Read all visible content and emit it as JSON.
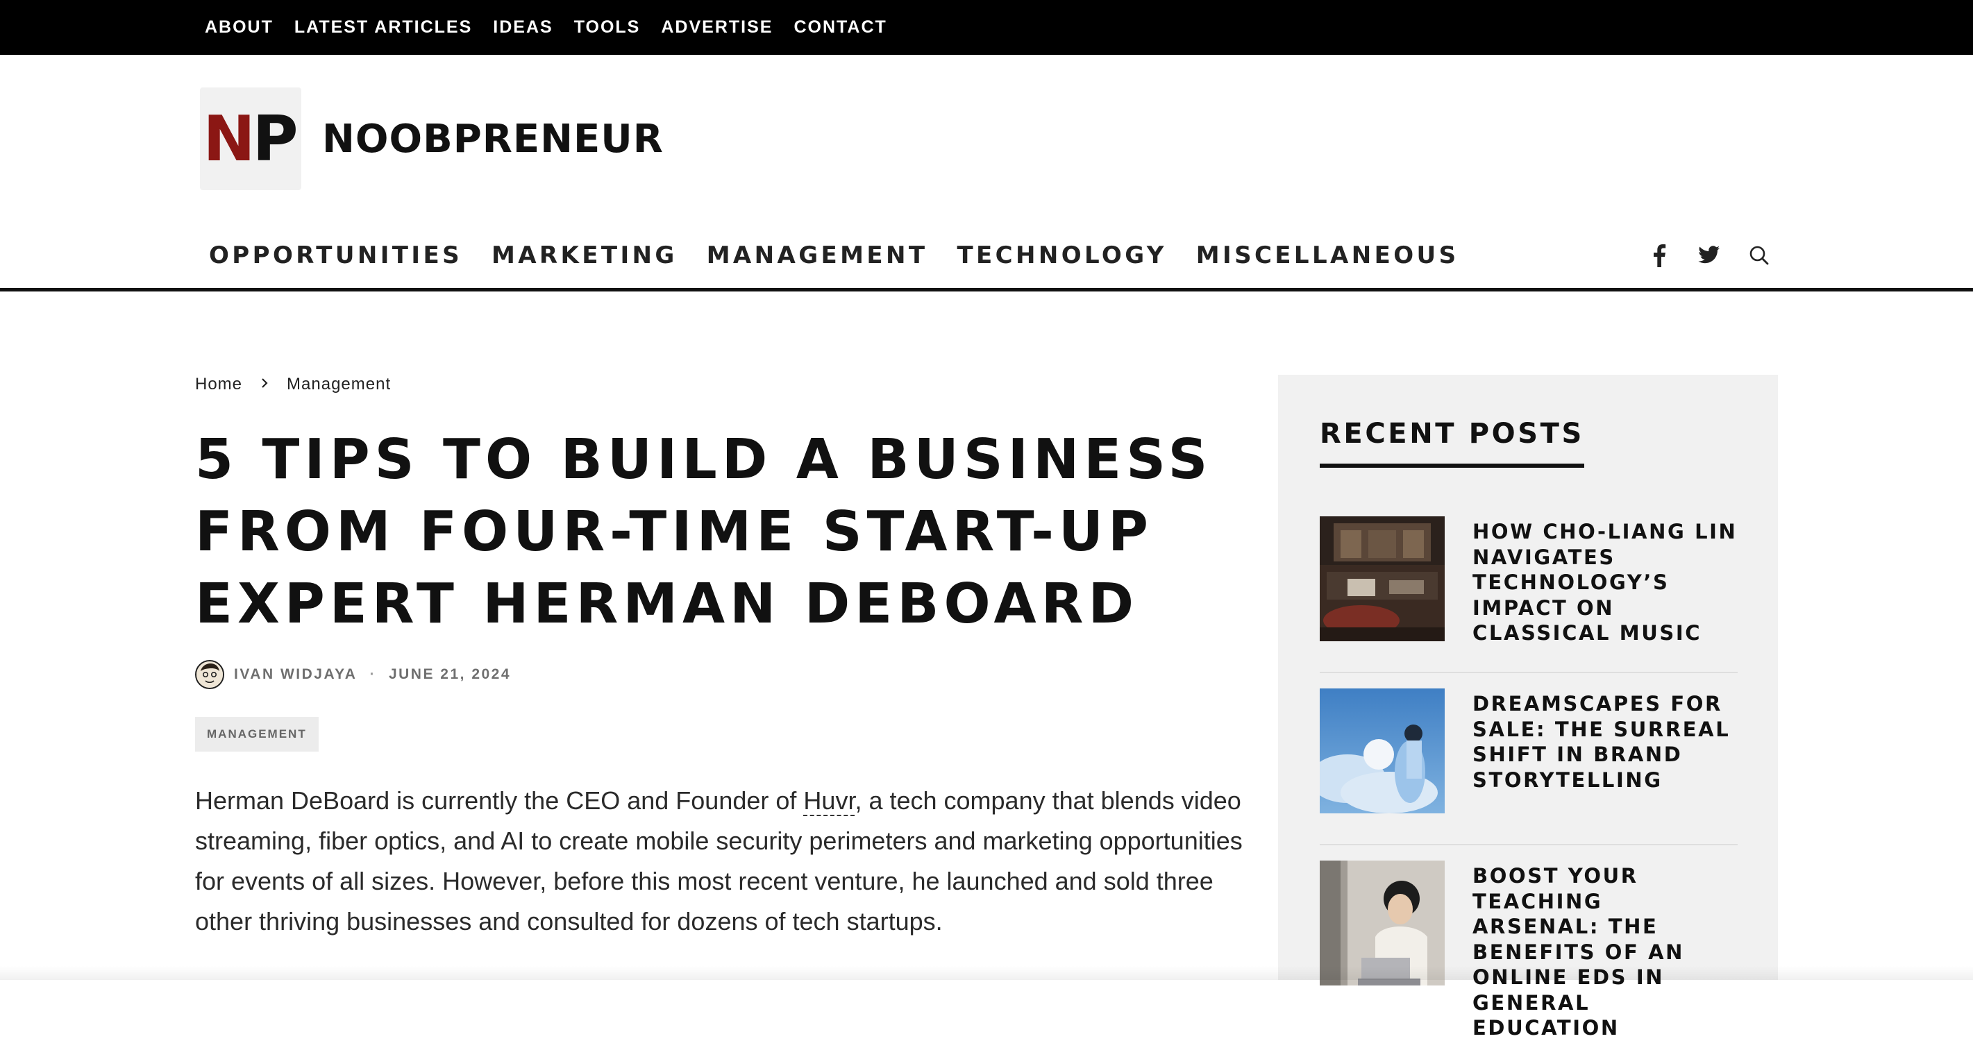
{
  "topbar": {
    "links": [
      "ABOUT",
      "LATEST ARTICLES",
      "IDEAS",
      "TOOLS",
      "ADVERTISE",
      "CONTACT"
    ]
  },
  "brand": {
    "logo_letter_1": "N",
    "logo_letter_2": "P",
    "name": "NOOBPRENEUR",
    "colors": {
      "logo_n": "#8b1714",
      "logo_p": "#111111"
    }
  },
  "mainnav": {
    "items": [
      "OPPORTUNITIES",
      "MARKETING",
      "MANAGEMENT",
      "TECHNOLOGY",
      "MISCELLANEOUS"
    ],
    "icons": [
      "facebook-icon",
      "twitter-icon",
      "search-icon"
    ]
  },
  "breadcrumb": {
    "home": "Home",
    "separator_icon": "chevron-right-icon",
    "current": "Management"
  },
  "article": {
    "title": "5 TIPS TO BUILD A BUSINESS FROM FOUR-TIME START-UP EXPERT HERMAN DEBOARD",
    "author": "IVAN WIDJAYA",
    "separator": "·",
    "date": "JUNE 21, 2024",
    "category": "MANAGEMENT",
    "body_before_link": "Herman DeBoard is currently the CEO and Founder of ",
    "body_link": "Huvr",
    "body_after_link": ", a tech company that blends video streaming, fiber optics, and AI to create mobile security perimeters and marketing opportunities for events of all sizes. However, before this most recent venture, he launched and sold three other thriving businesses and consulted for dozens of tech startups."
  },
  "sidebar": {
    "title": "RECENT POSTS",
    "posts": [
      {
        "title": "HOW CHO-LIANG LIN NAVIGATES TECHNOLOGY’S IMPACT ON CLASSICAL MUSIC"
      },
      {
        "title": "DREAMSCAPES FOR SALE: THE SURREAL SHIFT IN BRAND STORYTELLING"
      },
      {
        "title": "BOOST YOUR TEACHING ARSENAL: THE BENEFITS OF AN ONLINE EDS IN GENERAL EDUCATION"
      }
    ]
  }
}
